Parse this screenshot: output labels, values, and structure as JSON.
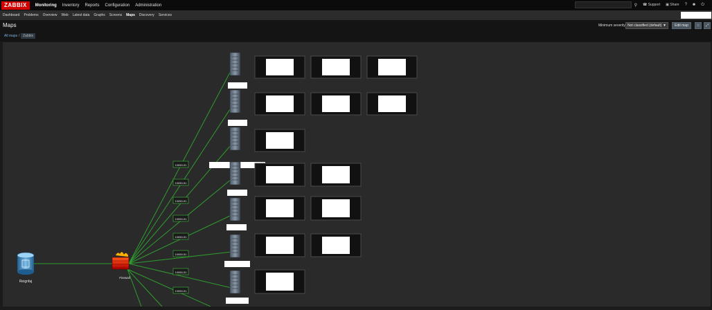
{
  "app": {
    "logo": "ZABBIX"
  },
  "main_nav": [
    "Monitoring",
    "Inventory",
    "Reports",
    "Configuration",
    "Administration"
  ],
  "top_right": {
    "support": "Support",
    "share": "Share",
    "help": "?"
  },
  "sub_nav": [
    "Dashboard",
    "Problems",
    "Overview",
    "Web",
    "Latest data",
    "Graphs",
    "Screens",
    "Maps",
    "Discovery",
    "Services"
  ],
  "header": {
    "title": "Maps",
    "min_severity_label": "Minimum severity",
    "min_severity_value": "Not classified (default)",
    "edit_map_label": "Edit map"
  },
  "breadcrumb": [
    "All maps",
    "Zabbix"
  ],
  "map": {
    "root_label": "Reignfaj",
    "firewall_label": "Firewall",
    "link_label": "10050-51",
    "link_colors": {
      "line": "#2e9e2e",
      "label_border": "#3fbf3f"
    }
  }
}
